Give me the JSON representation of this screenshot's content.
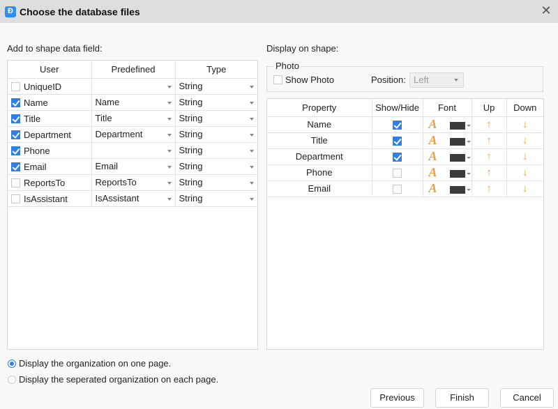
{
  "window": {
    "title": "Choose the database files",
    "app_icon": "edraw-logo-icon",
    "close_icon": "close-icon"
  },
  "left": {
    "label": "Add to shape data field:",
    "columns": [
      "User",
      "Predefined",
      "Type"
    ],
    "rows": [
      {
        "checked": false,
        "user": "UniqueID",
        "predefined": "",
        "type": "String"
      },
      {
        "checked": true,
        "user": "Name",
        "predefined": "Name",
        "type": "String"
      },
      {
        "checked": true,
        "user": "Title",
        "predefined": "Title",
        "type": "String"
      },
      {
        "checked": true,
        "user": "Department",
        "predefined": "Department",
        "type": "String"
      },
      {
        "checked": true,
        "user": "Phone",
        "predefined": "",
        "type": "String"
      },
      {
        "checked": true,
        "user": "Email",
        "predefined": "Email",
        "type": "String"
      },
      {
        "checked": false,
        "user": "ReportsTo",
        "predefined": "ReportsTo",
        "type": "String"
      },
      {
        "checked": false,
        "user": "IsAssistant",
        "predefined": "IsAssistant",
        "type": "String"
      }
    ]
  },
  "right": {
    "label": "Display on shape:",
    "photo": {
      "legend": "Photo",
      "show_photo_label": "Show Photo",
      "show_photo_checked": false,
      "position_label": "Position:",
      "position_value": "Left"
    },
    "columns": [
      "Property",
      "Show/Hide",
      "Font",
      "Up",
      "Down"
    ],
    "rows": [
      {
        "property": "Name",
        "shown": true,
        "font_color": "#3b3b3b"
      },
      {
        "property": "Title",
        "shown": true,
        "font_color": "#3b3b3b"
      },
      {
        "property": "Department",
        "shown": true,
        "font_color": "#3b3b3b"
      },
      {
        "property": "Phone",
        "shown": false,
        "font_color": "#3b3b3b"
      },
      {
        "property": "Email",
        "shown": false,
        "font_color": "#3b3b3b"
      }
    ],
    "font_glyph": "A",
    "up_glyph": "🡑",
    "down_glyph": "🡓"
  },
  "options": {
    "one_page": "Display the organization on one page.",
    "each_page": "Display the seperated organization on each page.",
    "selected": "one_page"
  },
  "buttons": {
    "previous": "Previous",
    "finish": "Finish",
    "cancel": "Cancel"
  },
  "colors": {
    "accent": "#2f7fe5",
    "icon_orange": "#f0a040"
  }
}
